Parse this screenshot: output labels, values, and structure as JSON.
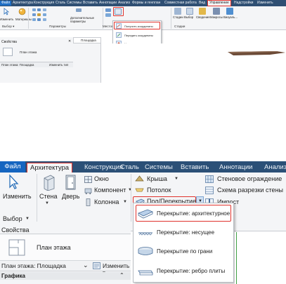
{
  "top": {
    "menu_tabs": [
      "Файл",
      "Архитектура",
      "Конструкция",
      "Сталь",
      "Системы",
      "Вставить",
      "Аннотации",
      "Анализ",
      "Формы и генплан",
      "Совместная работа",
      "Вид",
      "Управление",
      "Надстройки",
      "Изменить"
    ],
    "active_tab": "Управление",
    "ribbon_labels": {
      "modify": "Изменить",
      "materials": "Материалы",
      "additional_params": "Дополнительные параметры",
      "stages": "Стадии",
      "selection": "Выбор",
      "reports": "Сведения",
      "macros": "Макросы",
      "visual": "Визуаль..."
    },
    "group_labels": {
      "select": "Выбор ▾",
      "parameters": "Параметры",
      "location": "Местопо...",
      "stages": "Стадии"
    },
    "coords_menu": {
      "items": [
        "Получить координаты",
        "Передать координаты",
        "Указать координаты точки",
        "Выдать общие координаты"
      ],
      "highlighted": "Получить координаты"
    },
    "properties": {
      "title": "Свойства",
      "type": "План этажа",
      "selector": "План этажа: Площадка",
      "edit_type": "Изменить тип"
    },
    "view_tab": "Площадка"
  },
  "bottom": {
    "tabs": [
      "Файл",
      "Архитектура",
      "Конструкция",
      "Сталь",
      "Системы",
      "Вставить",
      "Аннотации",
      "Анализ"
    ],
    "active_tab": "Архитектура",
    "ribbon": {
      "modify": "Изменить",
      "select": "Выбор",
      "wall": "Стена",
      "door": "Дверь",
      "window": "Окно",
      "component": "Компонент",
      "column": "Колонна",
      "roof": "Крыша",
      "ceiling": "Потолок",
      "floor": "Пол/Перекрытие",
      "curtain_wall": "Стеновое ограждение",
      "curtain_grid": "Схема разрезки стены",
      "mullion": "Импост"
    },
    "floor_menu": {
      "items": [
        "Перекрытие: архитектурное",
        "Перекрытие: несущее",
        "Перекрытие по грани",
        "Перекрытие: ребро плиты"
      ],
      "highlighted": "Перекрытие: архитектурное"
    },
    "properties": {
      "title": "Свойства",
      "type": "План этажа",
      "selector": "План этажа: Площадка",
      "edit_type": "Изменить т",
      "section": "Графика"
    }
  },
  "colors": {
    "title_bar": "#2b5077",
    "file_tab": "#1565c0",
    "ribbon_bg": "#f4f5f7",
    "highlight_red": "#e0322c"
  }
}
